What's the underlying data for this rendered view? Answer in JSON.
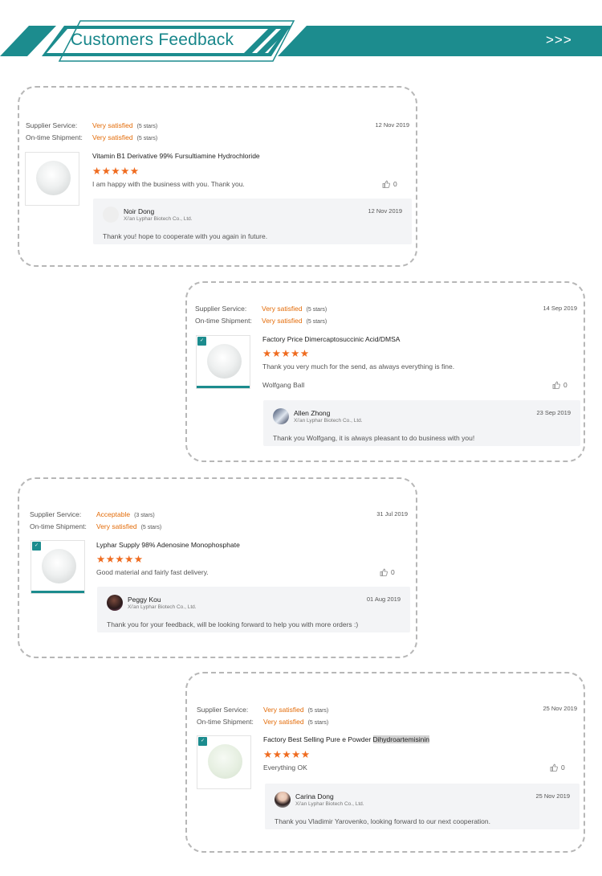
{
  "banner": {
    "title": "Customers Feedback",
    "arrows": ">>>",
    "teal_color": "#1c8c8e"
  },
  "labels": {
    "supplier_service": "Supplier Service:",
    "ontime_shipment": "On-time Shipment:"
  },
  "reviews": [
    {
      "supplier_rating": "Very satisfied",
      "supplier_stars": "(5 stars)",
      "shipment_rating": "Very satisfied",
      "shipment_stars": "(5 stars)",
      "date": "12 Nov 2019",
      "product_title": "Vitamin B1 Derivative 99% Fursultiamine Hydrochloride",
      "stars": "★★★★★",
      "rating": 5,
      "comment": "I am happy with the business with you. Thank you.",
      "author": "",
      "likes": "0",
      "reply": {
        "name": "Noir Dong",
        "company": "Xi'an Lyphar Biotech Co., Ltd.",
        "date": "12 Nov 2019",
        "text": "Thank you! hope to cooperate with you again in future."
      }
    },
    {
      "supplier_rating": "Very satisfied",
      "supplier_stars": "(5 stars)",
      "shipment_rating": "Very satisfied",
      "shipment_stars": "(5 stars)",
      "date": "14 Sep 2019",
      "product_title": "Factory Price Dimercaptosuccinic Acid/DMSA",
      "stars": "★★★★★",
      "rating": 5,
      "comment": "Thank you very much for the send, as always everything is fine.",
      "author": "Wolfgang Ball",
      "likes": "0",
      "reply": {
        "name": "Allen Zhong",
        "company": "Xi'an Lyphar Biotech Co., Ltd.",
        "date": "23 Sep 2019",
        "text": "Thank you Wolfgang, it is always pleasant to do business with you!"
      }
    },
    {
      "supplier_rating": "Acceptable",
      "supplier_stars": "(3 stars)",
      "shipment_rating": "Very satisfied",
      "shipment_stars": "(5 stars)",
      "date": "31 Jul 2019",
      "product_title": "Lyphar Supply 98% Adenosine Monophosphate",
      "stars": "★★★★★",
      "rating": 5,
      "comment": "Good material and fairly fast delivery.",
      "author": "",
      "likes": "0",
      "reply": {
        "name": "Peggy Kou",
        "company": "Xi'an Lyphar Biotech Co., Ltd.",
        "date": "01 Aug 2019",
        "text": "Thank you for your feedback, will be looking forward to help you with more orders :)"
      }
    },
    {
      "supplier_rating": "Very satisfied",
      "supplier_stars": "(5 stars)",
      "shipment_rating": "Very satisfied",
      "shipment_stars": "(5 stars)",
      "date": "25 Nov 2019",
      "product_title": "Factory Best Selling Pure e Powder ",
      "product_title_highlight": "Dihydroartemisinin",
      "stars": "★★★★★",
      "rating": 5,
      "comment": "Everything OK",
      "author": "",
      "likes": "0",
      "reply": {
        "name": "Carina Dong",
        "company": "Xi'an Lyphar Biotech Co., Ltd.",
        "date": "25 Nov 2019",
        "text": "Thank you Vladimir Yarovenko, looking forward to our next cooperation."
      }
    }
  ]
}
